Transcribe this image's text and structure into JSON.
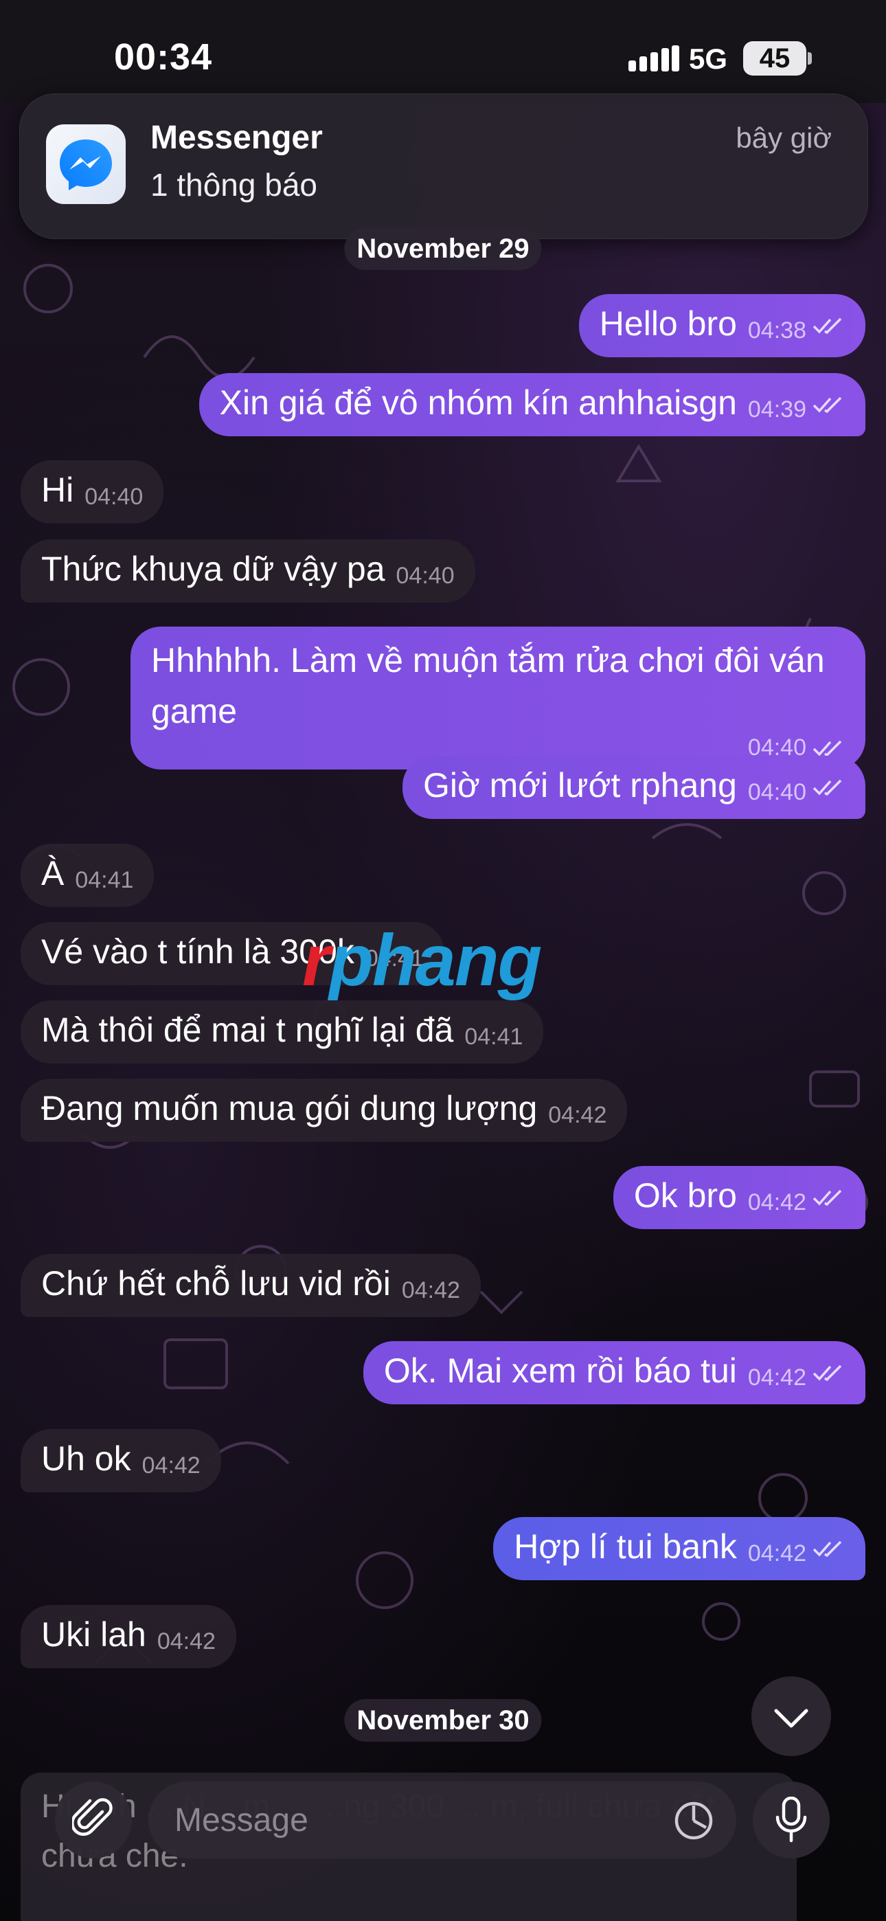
{
  "status_bar": {
    "time": "00:34",
    "network": "5G",
    "battery": "45"
  },
  "notification": {
    "app_name": "Messenger",
    "subtitle": "1 thông báo",
    "time": "bây giờ"
  },
  "dates": {
    "first": "November 29",
    "second": "November 30"
  },
  "messages": [
    {
      "dir": "out",
      "text": "Hello bro",
      "time": "04:38"
    },
    {
      "dir": "out",
      "text": "Xin giá để vô nhóm kín anhhaisgn",
      "time": "04:39"
    },
    {
      "dir": "in",
      "text": "Hi",
      "time": "04:40"
    },
    {
      "dir": "in",
      "text": "Thức khuya dữ vậy pa",
      "time": "04:40"
    },
    {
      "dir": "out",
      "text": "Hhhhhh. Làm về muộn tắm rửa chơi đôi ván game",
      "time": "04:40"
    },
    {
      "dir": "out",
      "text": "Giờ mới lướt rphang",
      "time": "04:40"
    },
    {
      "dir": "in",
      "text": "À",
      "time": "04:41"
    },
    {
      "dir": "in",
      "text": "Vé vào t tính là 300k",
      "time": "04:41"
    },
    {
      "dir": "in",
      "text": "Mà thôi để mai t nghĩ lại đã",
      "time": "04:41"
    },
    {
      "dir": "in",
      "text": "Đang muốn mua gói dung lượng",
      "time": "04:42"
    },
    {
      "dir": "out",
      "text": "Ok bro",
      "time": "04:42"
    },
    {
      "dir": "in",
      "text": "Chứ hết chỗ lưu vid rồi",
      "time": "04:42"
    },
    {
      "dir": "out",
      "text": "Ok. Mai xem rồi báo tui",
      "time": "04:42"
    },
    {
      "dir": "in",
      "text": "Uh ok",
      "time": "04:42"
    },
    {
      "dir": "out",
      "text": "Hợp lí tui bank",
      "time": "04:42"
    },
    {
      "dir": "in",
      "text": "Uki lah",
      "time": "04:42"
    }
  ],
  "watermark": {
    "first": "r",
    "rest": "phang"
  },
  "draft_preview": "Hi anh ... N... m ... ...ng 300 ... m, full chưa cắt chưa che.",
  "input": {
    "placeholder": "Message"
  },
  "icons": {
    "app": "messenger-icon",
    "attach": "paperclip-icon",
    "sticker": "sticker-clock-icon",
    "mic": "microphone-icon",
    "scroll": "chevron-down-icon",
    "read": "double-check-icon",
    "signal": "signal-bars-icon"
  },
  "colors": {
    "outgoing": "#7b4fe0",
    "incoming": "#28212b",
    "accent": "#8a52e6"
  }
}
